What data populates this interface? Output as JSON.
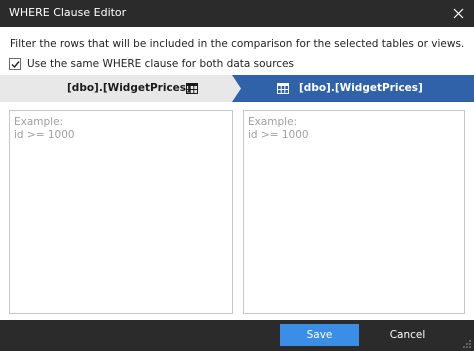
{
  "window": {
    "title": "WHERE Clause Editor"
  },
  "description": "Filter the rows that will be included in the comparison for the selected tables or views.",
  "same_clause_option": {
    "label": "Use the same WHERE clause for both data sources",
    "checked": true
  },
  "sources": {
    "left": {
      "label": "[dbo].[WidgetPrices]",
      "icon": "table-icon"
    },
    "right": {
      "label": "[dbo].[WidgetPrices]",
      "icon": "table-icon",
      "active": true
    }
  },
  "editors": {
    "left": {
      "value": "",
      "placeholder": "Example:\nid >= 1000"
    },
    "right": {
      "value": "",
      "placeholder": "Example:\nid >= 1000"
    }
  },
  "footer": {
    "save_label": "Save",
    "cancel_label": "Cancel"
  },
  "colors": {
    "titlebar": "#2b2b2b",
    "accent": "#2f62a8",
    "save_button": "#3a8ee6",
    "source_bar": "#e8e8e8"
  }
}
